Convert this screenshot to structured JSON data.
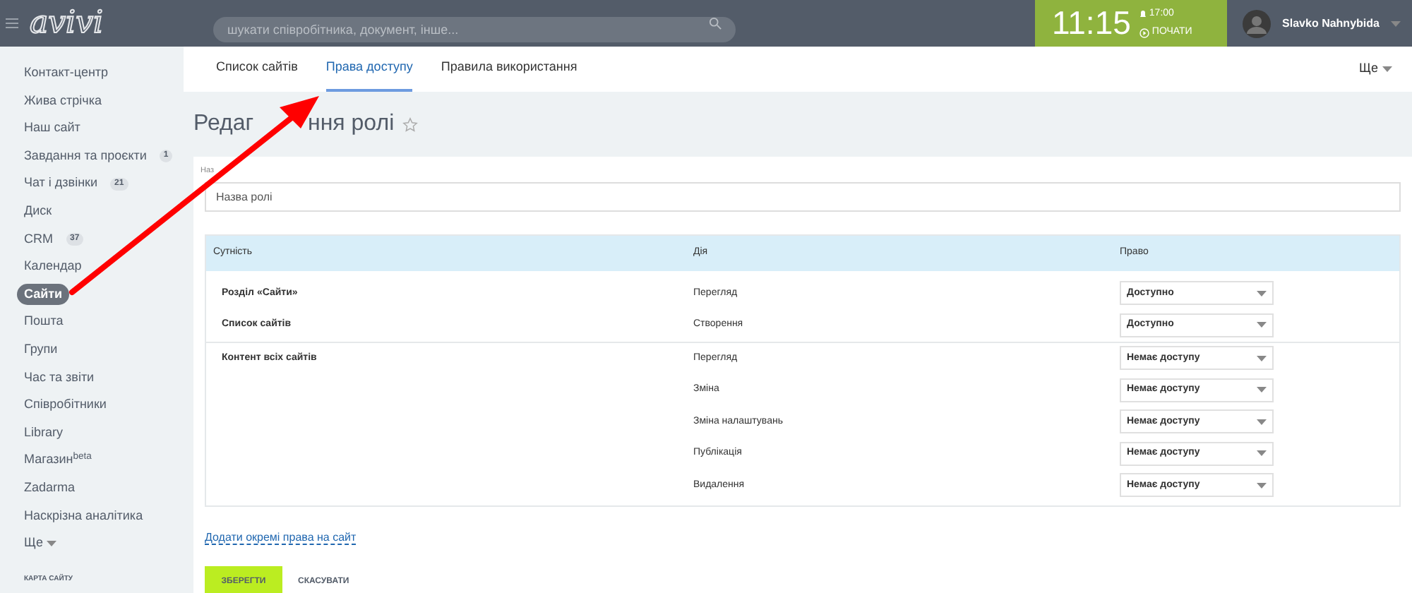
{
  "topbar": {
    "logo": "avivi",
    "search_placeholder": "шукати співробітника, документ, інше...",
    "clock": {
      "time": "11:15",
      "alarm": "17:00",
      "start": "ПОЧАТИ"
    },
    "user": "Slavko Nahnybida"
  },
  "sidebar": {
    "items": [
      {
        "label": "Контакт-центр",
        "selected": false
      },
      {
        "label": "Жива стрічка",
        "selected": false
      },
      {
        "label": "Наш сайт",
        "selected": false
      },
      {
        "label": "Завдання та проєкти",
        "count": "1",
        "selected": false
      },
      {
        "label": "Чат і дзвінки",
        "count": "21",
        "selected": false
      },
      {
        "label": "Диск",
        "selected": false
      },
      {
        "label": "CRM",
        "count": "37",
        "selected": false
      },
      {
        "label": "Календар",
        "selected": false
      },
      {
        "label": "Сайти",
        "selected": true
      },
      {
        "label": "Пошта",
        "selected": false
      },
      {
        "label": "Групи",
        "selected": false
      },
      {
        "label": "Час та звіти",
        "selected": false
      },
      {
        "label": "Співробітники",
        "selected": false
      },
      {
        "label": "Library",
        "selected": false
      },
      {
        "label": "Магазин$^{beta}$",
        "selected": false
      },
      {
        "label": "Zadarma",
        "selected": false
      },
      {
        "label": "Наскрізна аналітика",
        "selected": false
      }
    ],
    "more": "Ще",
    "sitemap": "КАРТА САЙТУ"
  },
  "tabs": [
    {
      "label": "Список сайтів",
      "selected": false
    },
    {
      "label": "Права доступу",
      "selected": true
    },
    {
      "label": "Правила використання",
      "selected": false
    }
  ],
  "tabs_more": "Ще",
  "page_title": [
    "Редаг",
    "ння ролі"
  ],
  "name_field": {
    "label": "Наз",
    "placeholder": "Назва ролі"
  },
  "table": {
    "columns": [
      "Сутність",
      "Дія",
      "Право"
    ],
    "groups": [
      {
        "entities": [
          {
            "name": "Розділ «Сайти»",
            "actions": [
              {
                "action": "Перегляд",
                "right": "Доступно"
              }
            ]
          },
          {
            "name": "Список сайтів",
            "actions": [
              {
                "action": "Створення",
                "right": "Доступно"
              }
            ]
          }
        ]
      },
      {
        "entities": [
          {
            "name": "Контент всіх сайтів",
            "actions": [
              {
                "action": "Перегляд",
                "right": "Немає доступу"
              },
              {
                "action": "Зміна",
                "right": "Немає доступу"
              },
              {
                "action": "Зміна налаштувань",
                "right": "Немає доступу"
              },
              {
                "action": "Публікація",
                "right": "Немає доступу"
              },
              {
                "action": "Видалення",
                "right": "Немає доступу"
              }
            ]
          }
        ]
      }
    ]
  },
  "add_link": "Додати окремі права на сайт",
  "buttons": {
    "save": "ЗБЕРЕГТИ",
    "cancel": "СКАСУВАТИ"
  }
}
